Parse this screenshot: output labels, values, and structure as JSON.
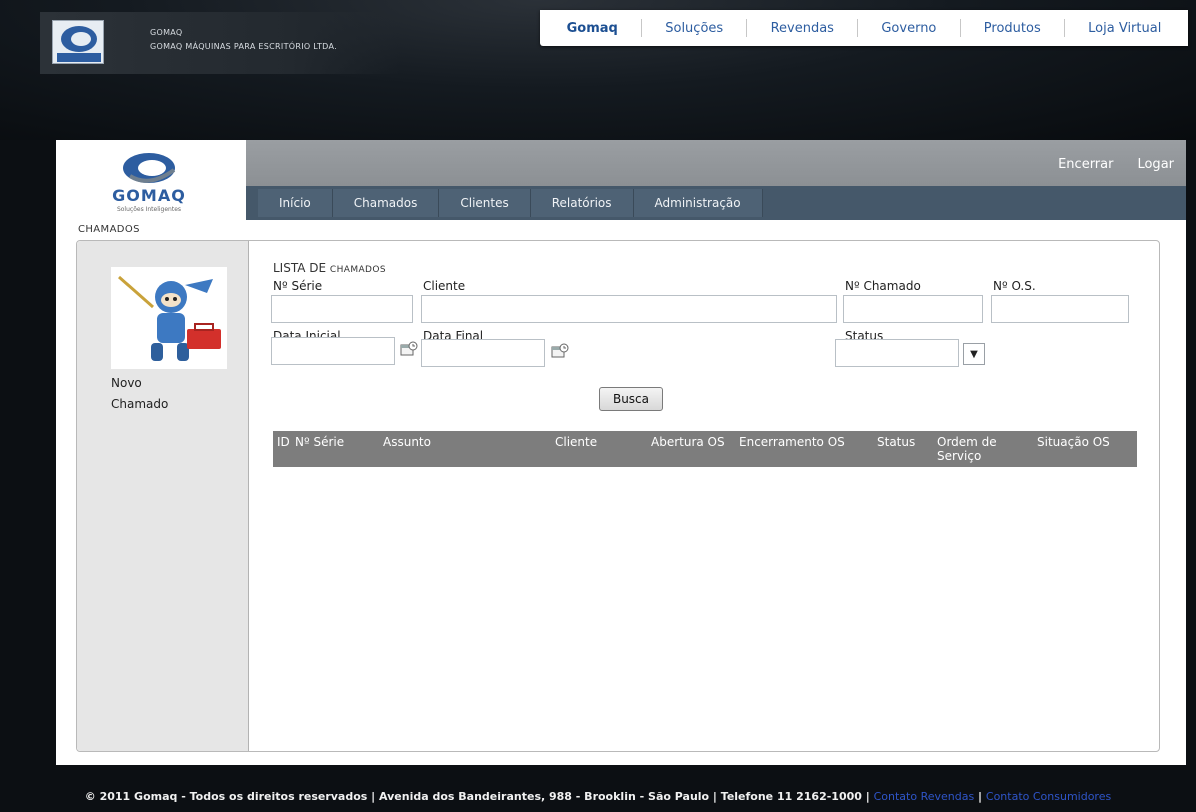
{
  "brand": {
    "company_short": "GOMAQ",
    "company_full": "GOMAQ MÁQUINAS PARA ESCRITÓRIO LTDA.",
    "logo_word": "GOMAQ",
    "logo_tagline": "Soluções Inteligentes"
  },
  "topnav": {
    "items": [
      "Gomaq",
      "Soluções",
      "Revendas",
      "Governo",
      "Produtos",
      "Loja Virtual"
    ]
  },
  "userlinks": {
    "close": "Encerrar",
    "login": "Logar"
  },
  "mainnav": {
    "items": [
      "Início",
      "Chamados",
      "Clientes",
      "Relatórios",
      "Administração"
    ]
  },
  "breadcrumb": "CHAMADOS",
  "sidebar": {
    "new_ticket_line1": "Novo",
    "new_ticket_line2": "Chamado"
  },
  "form": {
    "title_prefix": "LISTA DE ",
    "title_suffix": "CHAMADOS",
    "labels": {
      "serial": "Nº Série",
      "client": "Cliente",
      "ticket_no": "Nº Chamado",
      "os_no": "Nº O.S.",
      "start_date": "Data Inicial",
      "end_date": "Data Final",
      "status": "Status"
    },
    "values": {
      "serial": "",
      "client": "",
      "ticket_no": "",
      "os_no": "",
      "start_date": "",
      "end_date": "",
      "status": ""
    },
    "search_button": "Busca"
  },
  "table": {
    "columns": [
      "ID",
      "Nº Série",
      "Assunto",
      "Cliente",
      "Abertura OS",
      "Encerramento OS",
      "Status",
      "Ordem de Serviço",
      "Situação OS"
    ],
    "rows": []
  },
  "footer": {
    "text": "© 2011 Gomaq - Todos os direitos reservados | Avenida dos Bandeirantes, 988 - Brooklin - São Paulo | Telefone 11 2162-1000 | ",
    "link_resellers": "Contato Revendas",
    "separator": " | ",
    "link_consumers": "Contato Consumidores"
  },
  "colors": {
    "nav_dark": "#45586a",
    "grey_band": "#8f9397",
    "table_header": "#7d7d7d",
    "link_blue": "#2d5da0"
  }
}
